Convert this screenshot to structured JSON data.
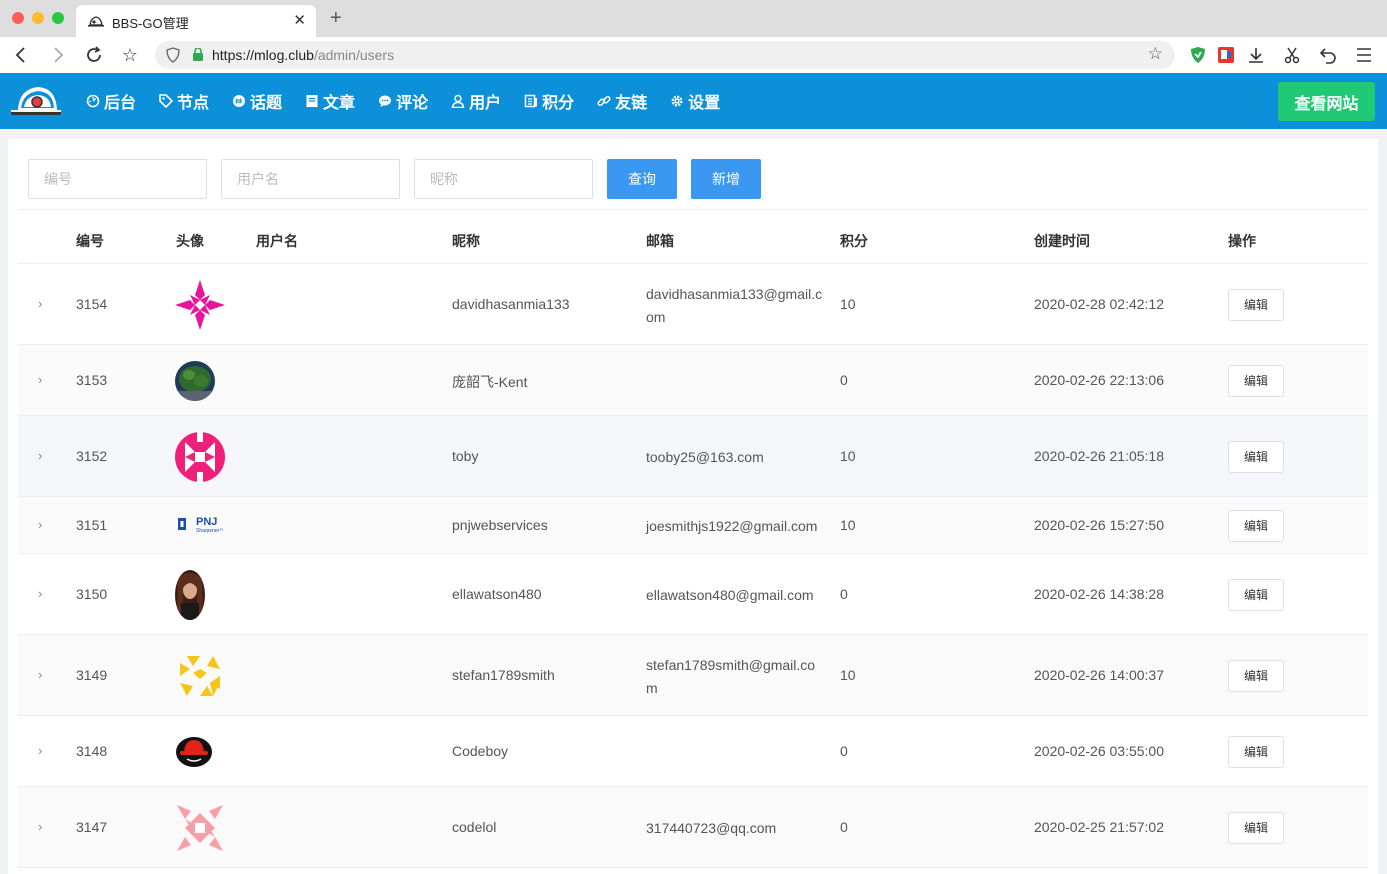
{
  "browser": {
    "tab_title": "BBS-GO管理",
    "url_host": "https://mlog.club",
    "url_path": "/admin/users"
  },
  "header": {
    "nav": [
      {
        "label": "后台",
        "icon": "dashboard-icon"
      },
      {
        "label": "节点",
        "icon": "tag-icon"
      },
      {
        "label": "话题",
        "icon": "topic-icon"
      },
      {
        "label": "文章",
        "icon": "article-icon"
      },
      {
        "label": "评论",
        "icon": "comment-icon"
      },
      {
        "label": "用户",
        "icon": "user-icon"
      },
      {
        "label": "积分",
        "icon": "score-icon"
      },
      {
        "label": "友链",
        "icon": "link-icon"
      },
      {
        "label": "设置",
        "icon": "gear-icon"
      }
    ],
    "view_site_label": "查看网站",
    "accent_color": "#0b90d9",
    "view_site_color": "#1fc975"
  },
  "filters": {
    "id_placeholder": "编号",
    "username_placeholder": "用户名",
    "nickname_placeholder": "昵称",
    "query_label": "查询",
    "add_label": "新增"
  },
  "table": {
    "columns": [
      "编号",
      "头像",
      "用户名",
      "昵称",
      "邮箱",
      "积分",
      "创建时间",
      "操作"
    ],
    "edit_label": "编辑",
    "rows": [
      {
        "id": "3154",
        "username": "",
        "nickname": "davidhasanmia133",
        "email": "davidhasanmia133@gmail.com",
        "score": "10",
        "created": "2020-02-28 02:42:12"
      },
      {
        "id": "3153",
        "username": "",
        "nickname": "庞韶飞-Kent",
        "email": "",
        "score": "0",
        "created": "2020-02-26 22:13:06"
      },
      {
        "id": "3152",
        "username": "",
        "nickname": "toby",
        "email": "tooby25@163.com",
        "score": "10",
        "created": "2020-02-26 21:05:18"
      },
      {
        "id": "3151",
        "username": "",
        "nickname": "pnjwebservices",
        "email": "joesmithjs1922@gmail.com",
        "score": "10",
        "created": "2020-02-26 15:27:50"
      },
      {
        "id": "3150",
        "username": "",
        "nickname": "ellawatson480",
        "email": "ellawatson480@gmail.com",
        "score": "0",
        "created": "2020-02-26 14:38:28"
      },
      {
        "id": "3149",
        "username": "",
        "nickname": "stefan1789smith",
        "email": "stefan1789smith@gmail.com",
        "score": "10",
        "created": "2020-02-26 14:00:37"
      },
      {
        "id": "3148",
        "username": "",
        "nickname": "Codeboy",
        "email": "",
        "score": "0",
        "created": "2020-02-26 03:55:00"
      },
      {
        "id": "3147",
        "username": "",
        "nickname": "codelol",
        "email": "317440723@qq.com",
        "score": "0",
        "created": "2020-02-25 21:57:02"
      }
    ]
  },
  "avatar_logo_text": {
    "pnj": "PNJ",
    "pnj_sub": "Sharpener™"
  }
}
